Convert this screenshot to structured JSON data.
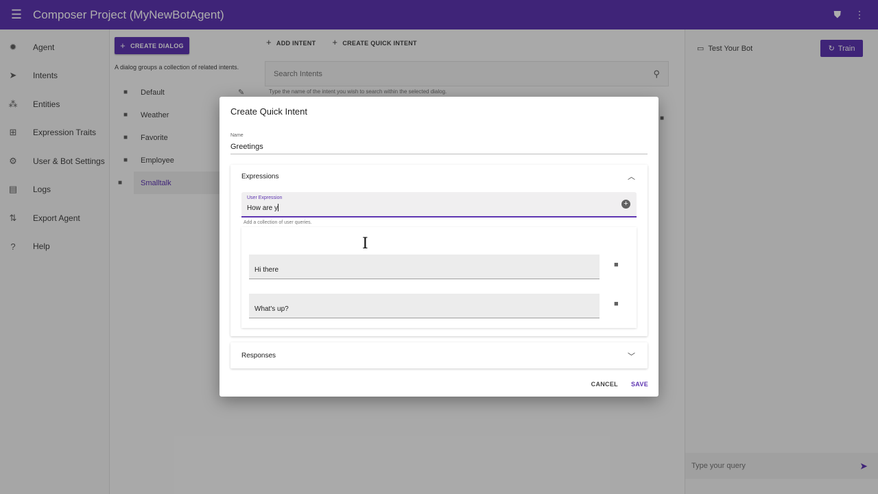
{
  "app": {
    "title": "Composer Project (MyNewBotAgent)"
  },
  "sidebar": {
    "items": [
      {
        "label": "Agent",
        "icon": "agent-icon"
      },
      {
        "label": "Intents",
        "icon": "intents-icon"
      },
      {
        "label": "Entities",
        "icon": "entities-icon"
      },
      {
        "label": "Expression Traits",
        "icon": "traits-icon"
      },
      {
        "label": "User & Bot Settings",
        "icon": "settings-icon"
      },
      {
        "label": "Logs",
        "icon": "logs-icon"
      },
      {
        "label": "Export Agent",
        "icon": "export-icon"
      },
      {
        "label": "Help",
        "icon": "help-icon"
      }
    ]
  },
  "dialogs": {
    "create_label": "CREATE DIALOG",
    "description": "A dialog groups a collection of related intents.",
    "items": [
      "Default",
      "Weather",
      "Favorite",
      "Employee",
      "Smalltalk"
    ],
    "selected": "Smalltalk"
  },
  "intents": {
    "add_label": "ADD INTENT",
    "quick_label": "CREATE QUICK INTENT",
    "search_placeholder": "Search Intents",
    "search_hint": "Type the name of the intent you wish to search within the selected dialog."
  },
  "test_panel": {
    "title": "Test Your Bot",
    "train_label": "Train",
    "query_placeholder": "Type your query"
  },
  "modal": {
    "title": "Create Quick Intent",
    "name_label": "Name",
    "name_value": "Greetings",
    "expressions_label": "Expressions",
    "user_expression_label": "User Expression",
    "user_expression_value": "How are y",
    "expression_hint": "Add a collection of user queries.",
    "expressions": [
      "Hi there",
      "What's up?"
    ],
    "responses_label": "Responses",
    "cancel_label": "CANCEL",
    "save_label": "SAVE"
  },
  "colors": {
    "primary": "#5e35b1"
  }
}
